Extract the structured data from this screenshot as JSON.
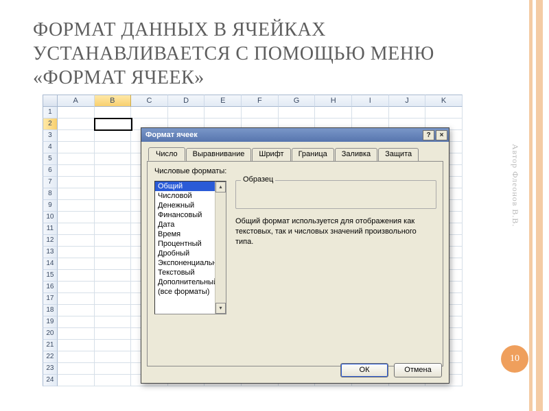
{
  "slide": {
    "title": "ФОРМАТ ДАННЫХ В ЯЧЕЙКАХ УСТАНАВЛИВАЕТСЯ С ПОМОЩЬЮ МЕНЮ «ФОРМАТ ЯЧЕЕК»",
    "author": "Автор Флеонов В.В.",
    "page_number": "10"
  },
  "sheet": {
    "columns": [
      "A",
      "B",
      "C",
      "D",
      "E",
      "F",
      "G",
      "H",
      "I",
      "J",
      "K"
    ],
    "rows": [
      "1",
      "2",
      "3",
      "4",
      "5",
      "6",
      "7",
      "8",
      "9",
      "10",
      "11",
      "12",
      "13",
      "14",
      "15",
      "16",
      "17",
      "18",
      "19",
      "20",
      "21",
      "22",
      "23",
      "24"
    ],
    "active": {
      "col": "B",
      "row": "2"
    }
  },
  "dialog": {
    "title": "Формат ячеек",
    "help_btn": "?",
    "close_btn": "×",
    "tabs": [
      "Число",
      "Выравнивание",
      "Шрифт",
      "Граница",
      "Заливка",
      "Защита"
    ],
    "active_tab_index": 0,
    "list_label": "Числовые форматы:",
    "formats": [
      "Общий",
      "Числовой",
      "Денежный",
      "Финансовый",
      "Дата",
      "Время",
      "Процентный",
      "Дробный",
      "Экспоненциальный",
      "Текстовый",
      "Дополнительный",
      "(все форматы)"
    ],
    "selected_format_index": 0,
    "sample_label": "Образец",
    "description": "Общий формат используется для отображения как текстовых, так и числовых значений произвольного типа.",
    "ok_label": "ОК",
    "cancel_label": "Отмена"
  }
}
